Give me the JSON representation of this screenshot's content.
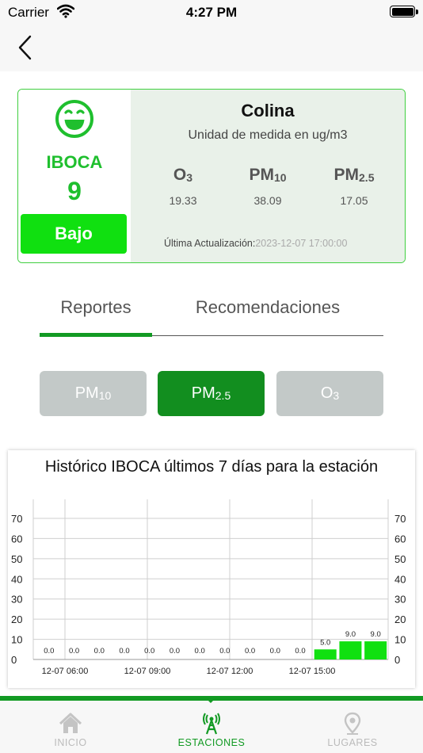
{
  "status_bar": {
    "carrier": "Carrier",
    "time": "4:27 PM"
  },
  "nav": {
    "back_icon": "chevron-left-icon"
  },
  "station": {
    "iboca_label": "IBOCA",
    "iboca_value": "9",
    "level": "Bajo",
    "face_icon": "smiling-face-icon",
    "name": "Colina",
    "unit": "Unidad de medida en ug/m3",
    "pollutants": [
      {
        "base": "O",
        "sub": "3",
        "value": "19.33"
      },
      {
        "base": "PM",
        "sub": "10",
        "value": "38.09"
      },
      {
        "base": "PM",
        "sub": "2.5",
        "value": "17.05"
      }
    ],
    "update_label": "Última Actualización:",
    "update_time": "2023-12-07 17:00:00",
    "colors": {
      "accent": "#1fbf2e",
      "badge": "#10e010",
      "panel": "#e9f1e9"
    }
  },
  "tabs": {
    "reportes": "Reportes",
    "recomendaciones": "Recomendaciones",
    "active": "Reportes"
  },
  "selector": [
    {
      "base": "PM",
      "sub": "10",
      "active": false
    },
    {
      "base": "PM",
      "sub": "2.5",
      "active": true
    },
    {
      "base": "O",
      "sub": "3",
      "active": false
    }
  ],
  "chart_data": {
    "type": "bar",
    "title": "Histórico IBOCA últimos 7 días para la estación",
    "ylim": [
      0,
      70
    ],
    "yticks": [
      0,
      10,
      20,
      30,
      40,
      50,
      60,
      70
    ],
    "xticks": [
      "12-07 06:00",
      "12-07 09:00",
      "12-07 12:00",
      "12-07 15:00"
    ],
    "value_labels": [
      "0.0",
      "0.0",
      "0.0",
      "0.0",
      "0.0",
      "0.0",
      "0.0",
      "0.0",
      "0.0",
      "0.0",
      "0.0",
      "5.0",
      "9.0",
      "9.0"
    ],
    "values": [
      0,
      0,
      0,
      0,
      0,
      0,
      0,
      0,
      0,
      0,
      0,
      5,
      9,
      9
    ],
    "grid": true,
    "bar_color": "#10e010"
  },
  "bottom_nav": [
    {
      "label": "INICIO",
      "icon": "home-icon",
      "active": false
    },
    {
      "label": "ESTACIONES",
      "icon": "antenna-icon",
      "active": true
    },
    {
      "label": "LUGARES",
      "icon": "map-pin-icon",
      "active": false
    }
  ]
}
